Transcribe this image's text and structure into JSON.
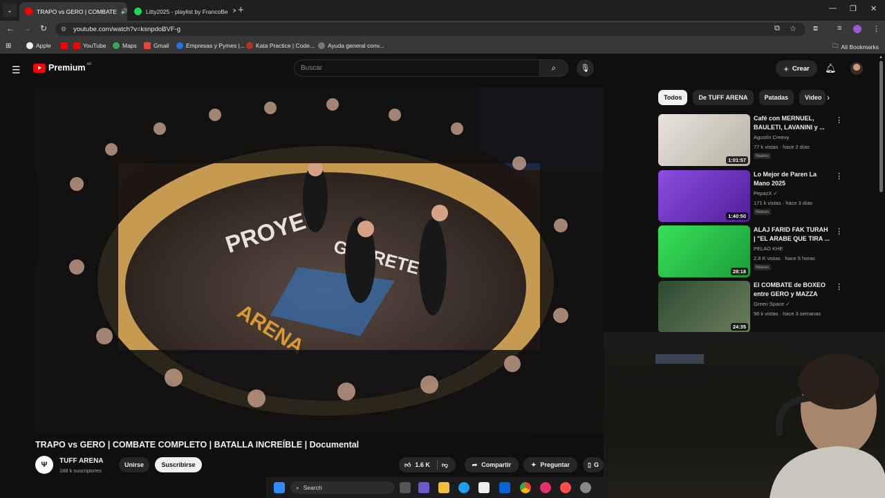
{
  "browser": {
    "tabs": [
      {
        "label": "TRAPO vs GERO | COMBATE",
        "active": true
      },
      {
        "label": "Litty2025 - playlist by FrancoBe",
        "active": false
      }
    ],
    "url": "youtube.com/watch?v=ksnpdoBVF-g",
    "bookmarks": [
      "Apple",
      "YouTube",
      "Maps",
      "Gmail",
      "Empresas y Pymes |...",
      "Kata Practice | Code...",
      "Ayuda general conv..."
    ],
    "all_bookmarks": "All Bookmarks"
  },
  "header": {
    "logo_text": "Premium",
    "region": "AR",
    "search_placeholder": "Buscar",
    "create_label": "Crear"
  },
  "video": {
    "title": "TRAPO vs GERO | COMBATE COMPLETO | BATALLA INCREÍBLE | Documental",
    "channel": "TUFF ARENA",
    "subscribers": "188 k suscriptores",
    "join_label": "Unirse",
    "subscribe_label": "Suscribirse",
    "likes": "1.6 K",
    "share_label": "Compartir",
    "ask_label": "Preguntar",
    "save_label": "G"
  },
  "chips": [
    "Todos",
    "De TUFF ARENA",
    "Patadas",
    "Video"
  ],
  "recommendations": [
    {
      "title": "Café con MERNUEL, BAULETI, LAVANINI y ...",
      "channel": "Agustín Creevy",
      "verified": false,
      "meta": "77 k vistas · hace 2 días",
      "badge": "Nuevo",
      "duration": "1:01:57",
      "thumb_color": "#d8d4cc"
    },
    {
      "title": "Lo Mejor de Paren La Mano 2025",
      "channel": "PepazX",
      "verified": true,
      "meta": "171 k vistas · hace 3 días",
      "badge": "Nuevo",
      "duration": "1:40:50",
      "thumb_color": "#7a3fd0"
    },
    {
      "title": "ALAJ FARID FAK TURAH | \"EL ARABE QUE TIRA ...",
      "channel": "PELAO KHE",
      "verified": false,
      "meta": "2.8 K vistas · hace 5 horas",
      "badge": "Nuevo",
      "duration": "28:18",
      "thumb_color": "#2bd14a"
    },
    {
      "title": "El COMBATE de BOXEO entre GERO y MAZZA",
      "channel": "Green Space",
      "verified": true,
      "meta": "98 k vistas · hace 3 semanas",
      "badge": "",
      "duration": "24:35",
      "thumb_color": "#3a5b3a"
    }
  ],
  "taskbar": {
    "search_label": "Search"
  },
  "icons": {
    "search": "search-icon",
    "mic": "mic-icon",
    "bell": "bell-icon",
    "like": "thumbs-up-icon",
    "dislike": "thumbs-down-icon",
    "share": "share-icon",
    "ask": "sparkle-icon",
    "save": "bookmark-icon"
  }
}
